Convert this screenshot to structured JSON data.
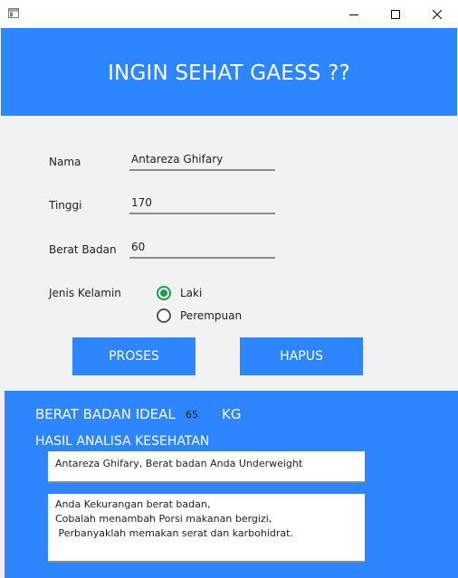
{
  "window": {
    "app_icon": "window-app-icon",
    "controls": [
      "minimize-icon",
      "maximize-icon",
      "close-icon"
    ]
  },
  "header": {
    "title": "INGIN SEHAT GAESS ??"
  },
  "form": {
    "nama_label": "Nama",
    "nama_value": "Antareza Ghifary",
    "tinggi_label": "Tinggi",
    "tinggi_value": "170",
    "berat_label": "Berat Badan",
    "berat_value": "60",
    "jenis_label": "Jenis Kelamin",
    "gender_options": [
      "Laki",
      "Perempuan"
    ],
    "gender_selected": "Laki"
  },
  "buttons": {
    "proses": "PROSES",
    "hapus": "HAPUS"
  },
  "result": {
    "ideal_label": "BERAT BADAN IDEAL",
    "ideal_value": "65",
    "ideal_unit": "KG",
    "analysis_label": "HASIL ANALISA KESEHATAN",
    "summary": "Antareza Ghifary, Berat badan Anda Underweight",
    "advice_lines": [
      "Anda Kekurangan berat badan,",
      "Cobalah menambah Porsi makanan bergizi,",
      " Perbanyaklah memakan serat dan karbohidrat."
    ]
  },
  "colors": {
    "accent": "#2d86ff",
    "radio_checked": "#15a04b",
    "background": "#f0f0f0"
  }
}
